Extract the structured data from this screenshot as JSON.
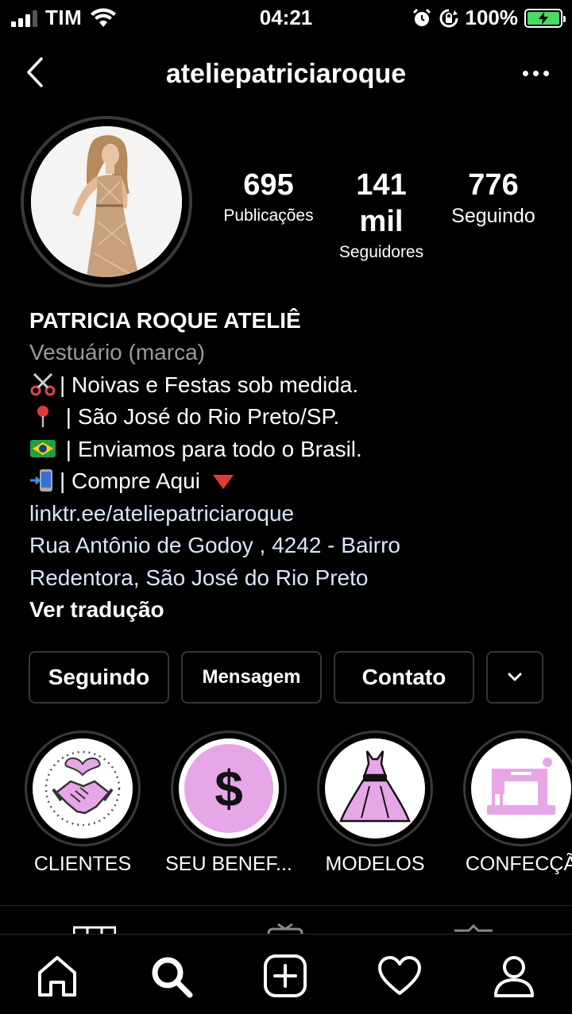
{
  "status_bar": {
    "carrier": "TIM",
    "time": "04:21",
    "battery_percent": "100%"
  },
  "header": {
    "username": "ateliepatriciaroque"
  },
  "stats": [
    {
      "value": "695",
      "label": "Publicações"
    },
    {
      "value": "141 mil",
      "label": "Seguidores"
    },
    {
      "value": "776",
      "label": "Seguindo"
    }
  ],
  "bio": {
    "name": "PATRICIA ROQUE ATELIÊ",
    "category": "Vestuário (marca)",
    "line1": "| Noivas e Festas sob medida.",
    "line2": " | São José do Rio Preto/SP.",
    "line3": " | Enviamos para todo o Brasil.",
    "line4": "| Compre Aqui ",
    "link": "linktr.ee/ateliepatriciaroque",
    "address_line1": "Rua Antônio de Godoy , 4242 - Bairro",
    "address_line2": "Redentora, São José do Rio Preto",
    "translate": "Ver tradução"
  },
  "actions": {
    "following": "Seguindo",
    "message": "Mensagem",
    "contact": "Contato"
  },
  "highlights": [
    {
      "label": "CLIENTES",
      "icon": "handshake-heart-icon"
    },
    {
      "label": "SEU BENEF...",
      "icon": "dollar-icon"
    },
    {
      "label": "MODELOS",
      "icon": "dress-icon"
    },
    {
      "label": "CONFECÇÃ",
      "icon": "sewing-machine-icon"
    }
  ],
  "colors": {
    "background": "#000000",
    "highlight_pink": "#e7a6e8",
    "link": "#d9e6ff",
    "muted": "#9b9b9b",
    "battery": "#4cd964"
  },
  "nav": [
    "home-icon",
    "search-icon",
    "add-post-icon",
    "activity-heart-icon",
    "profile-icon"
  ]
}
